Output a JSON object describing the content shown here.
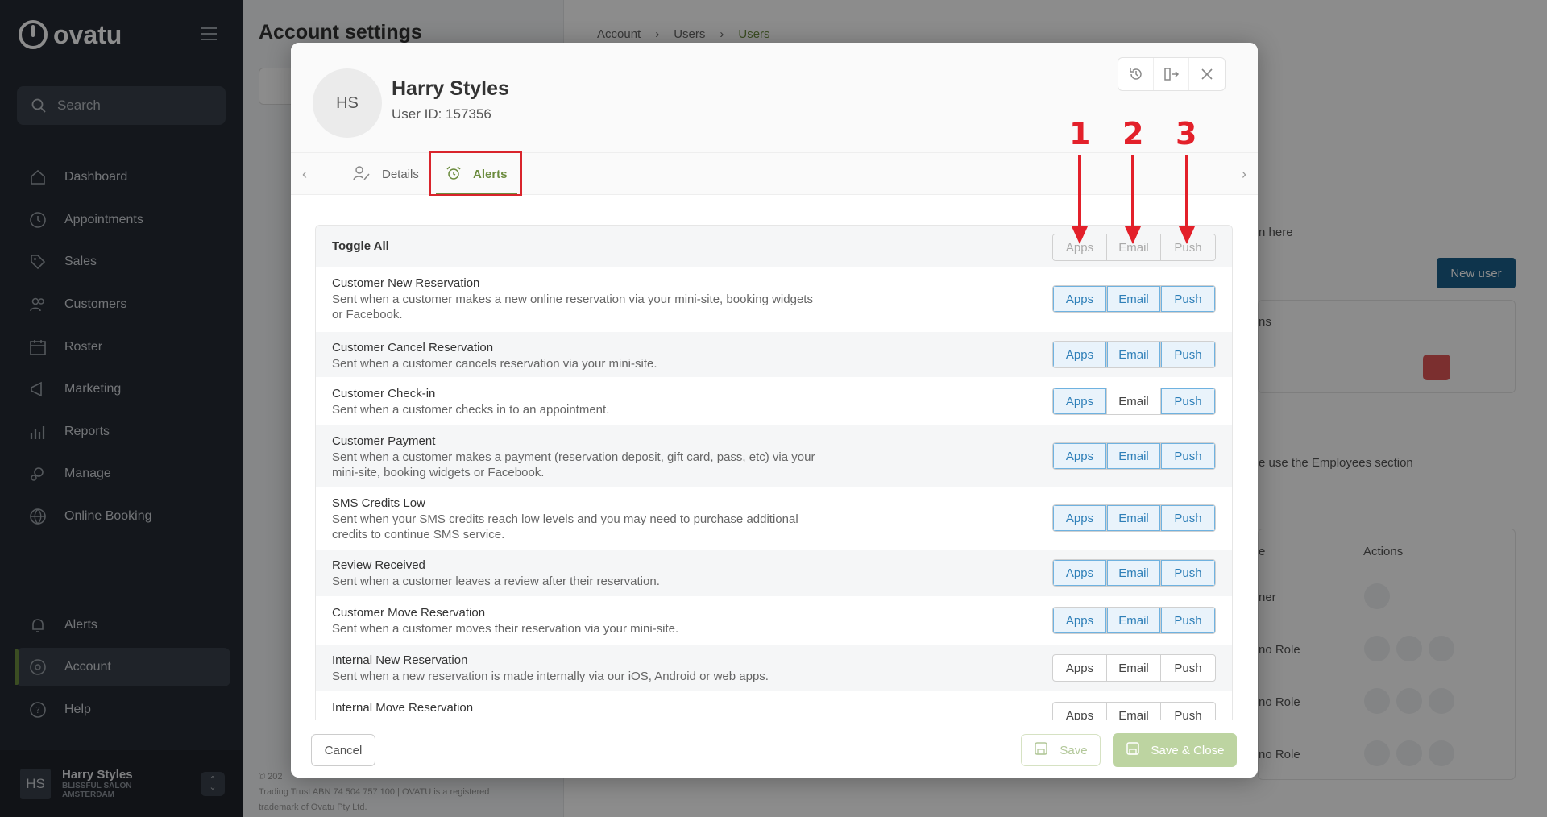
{
  "sidebar": {
    "logo_text": "ovatu",
    "search_label": "Search",
    "nav": [
      {
        "label": "Dashboard",
        "icon": "home-icon"
      },
      {
        "label": "Appointments",
        "icon": "clock-icon"
      },
      {
        "label": "Sales",
        "icon": "tag-icon"
      },
      {
        "label": "Customers",
        "icon": "users-icon"
      },
      {
        "label": "Roster",
        "icon": "calendar-icon"
      },
      {
        "label": "Marketing",
        "icon": "megaphone-icon"
      },
      {
        "label": "Reports",
        "icon": "chart-icon"
      },
      {
        "label": "Manage",
        "icon": "gears-icon"
      },
      {
        "label": "Online Booking",
        "icon": "globe-icon"
      }
    ],
    "bottom_nav": [
      {
        "label": "Alerts",
        "icon": "bell-icon"
      },
      {
        "label": "Account",
        "icon": "account-icon"
      },
      {
        "label": "Help",
        "icon": "help-icon"
      }
    ],
    "user": {
      "initials": "HS",
      "name": "Harry Styles",
      "org_line1": "BLISSFUL SALON",
      "org_line2": "AMSTERDAM"
    }
  },
  "background": {
    "title": "Account settings",
    "breadcrumbs": [
      "Account",
      "Users",
      "Users"
    ],
    "fragment_here": "n here",
    "new_user": "New user",
    "col_ns": "ns",
    "employees_note": "e use the Employees section",
    "col_e": "e",
    "actions": "Actions",
    "role_owner": "ner",
    "role_none": "no Role",
    "footer_line1": "© 202",
    "footer_line2": "Trading Trust ABN 74 504 757 100 | OVATU is a registered",
    "footer_line3": "trademark of Ovatu Pty Ltd."
  },
  "modal": {
    "avatar_initials": "HS",
    "name": "Harry Styles",
    "user_id": "User ID: 157356",
    "tabs": [
      {
        "label": "Details",
        "icon": "user-edit-icon"
      },
      {
        "label": "Alerts",
        "icon": "alarm-icon"
      }
    ],
    "annotations": [
      "1",
      "2",
      "3"
    ],
    "columns": [
      "Apps",
      "Email",
      "Push"
    ],
    "toggle_all": "Toggle All",
    "alerts": [
      {
        "title": "Customer New Reservation",
        "desc": "Sent when a customer makes a new online reservation via your mini-site, booking widgets or Facebook.",
        "apps": true,
        "email": true,
        "push": true
      },
      {
        "title": "Customer Cancel Reservation",
        "desc": "Sent when a customer cancels reservation via your mini-site.",
        "apps": true,
        "email": true,
        "push": true
      },
      {
        "title": "Customer Check-in",
        "desc": "Sent when a customer checks in to an appointment.",
        "apps": true,
        "email": false,
        "push": true
      },
      {
        "title": "Customer Payment",
        "desc": "Sent when a customer makes a payment (reservation deposit, gift card, pass, etc) via your mini-site, booking widgets or Facebook.",
        "apps": true,
        "email": true,
        "push": true
      },
      {
        "title": "SMS Credits Low",
        "desc": "Sent when your SMS credits reach low levels and you may need to purchase additional credits to continue SMS service.",
        "apps": true,
        "email": true,
        "push": true
      },
      {
        "title": "Review Received",
        "desc": "Sent when a customer leaves a review after their reservation.",
        "apps": true,
        "email": true,
        "push": true
      },
      {
        "title": "Customer Move Reservation",
        "desc": "Sent when a customer moves their reservation via your mini-site.",
        "apps": true,
        "email": true,
        "push": true
      },
      {
        "title": "Internal New Reservation",
        "desc": "Sent when a new reservation is made internally via our iOS, Android or web apps.",
        "apps": false,
        "email": false,
        "push": false
      },
      {
        "title": "Internal Move Reservation",
        "desc": "",
        "apps": false,
        "email": false,
        "push": false
      }
    ],
    "cancel": "Cancel",
    "save": "Save",
    "save_close": "Save & Close"
  },
  "colors": {
    "sidebar_bg": "#252b33",
    "accent_green": "#6c8c3f",
    "active_blue": "#2e7fb8",
    "annotation_red": "#e3202a"
  }
}
